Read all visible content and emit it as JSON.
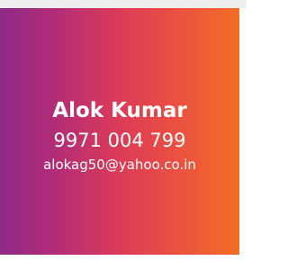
{
  "contact_card": {
    "name": "Alok Kumar",
    "phone": "9971 004 799",
    "email": "alokag50@yahoo.co.in"
  },
  "colors": {
    "gradient_start": "#8f2a86",
    "gradient_mid": "#d93a5a",
    "gradient_end": "#f26e26",
    "text": "#ffffff",
    "top_strip": "#efefef"
  }
}
